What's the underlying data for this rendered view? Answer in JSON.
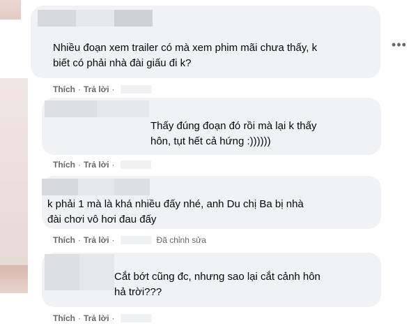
{
  "comments": [
    {
      "text": "Nhiều đoạn xem trailer có mà xem phim mãi chưa thấy, k\nbiết có phải nhà đài giấu đi k?",
      "like": "Thích",
      "reply": "Trả lời",
      "sep": "·",
      "edited": ""
    },
    {
      "text": "Thấy đúng đoạn đó rồi mà lại k thấy\nhôn, tụt hết cả hứng :))))))",
      "like": "Thích",
      "reply": "Trả lời",
      "sep": "·",
      "edited": ""
    },
    {
      "text": "k phải 1 mà là khá nhiều đấy nhé, anh Du chị Ba bị nhà\nđài chơi vô hơi đau đấy",
      "like": "Thích",
      "reply": "Trả lời",
      "sep": "·",
      "edited": "Đã chỉnh sửa"
    },
    {
      "text": "Cắt bớt cũng đc, nhưng sao lại cắt cảnh hôn\nhả trời???",
      "like": "Thích",
      "reply": "Trả lời",
      "sep": "·",
      "edited": ""
    }
  ],
  "more_icon": "more-horizontal-icon",
  "colors": {
    "bubble": "#f0f2f5",
    "meta": "#65676b",
    "text": "#050505"
  }
}
